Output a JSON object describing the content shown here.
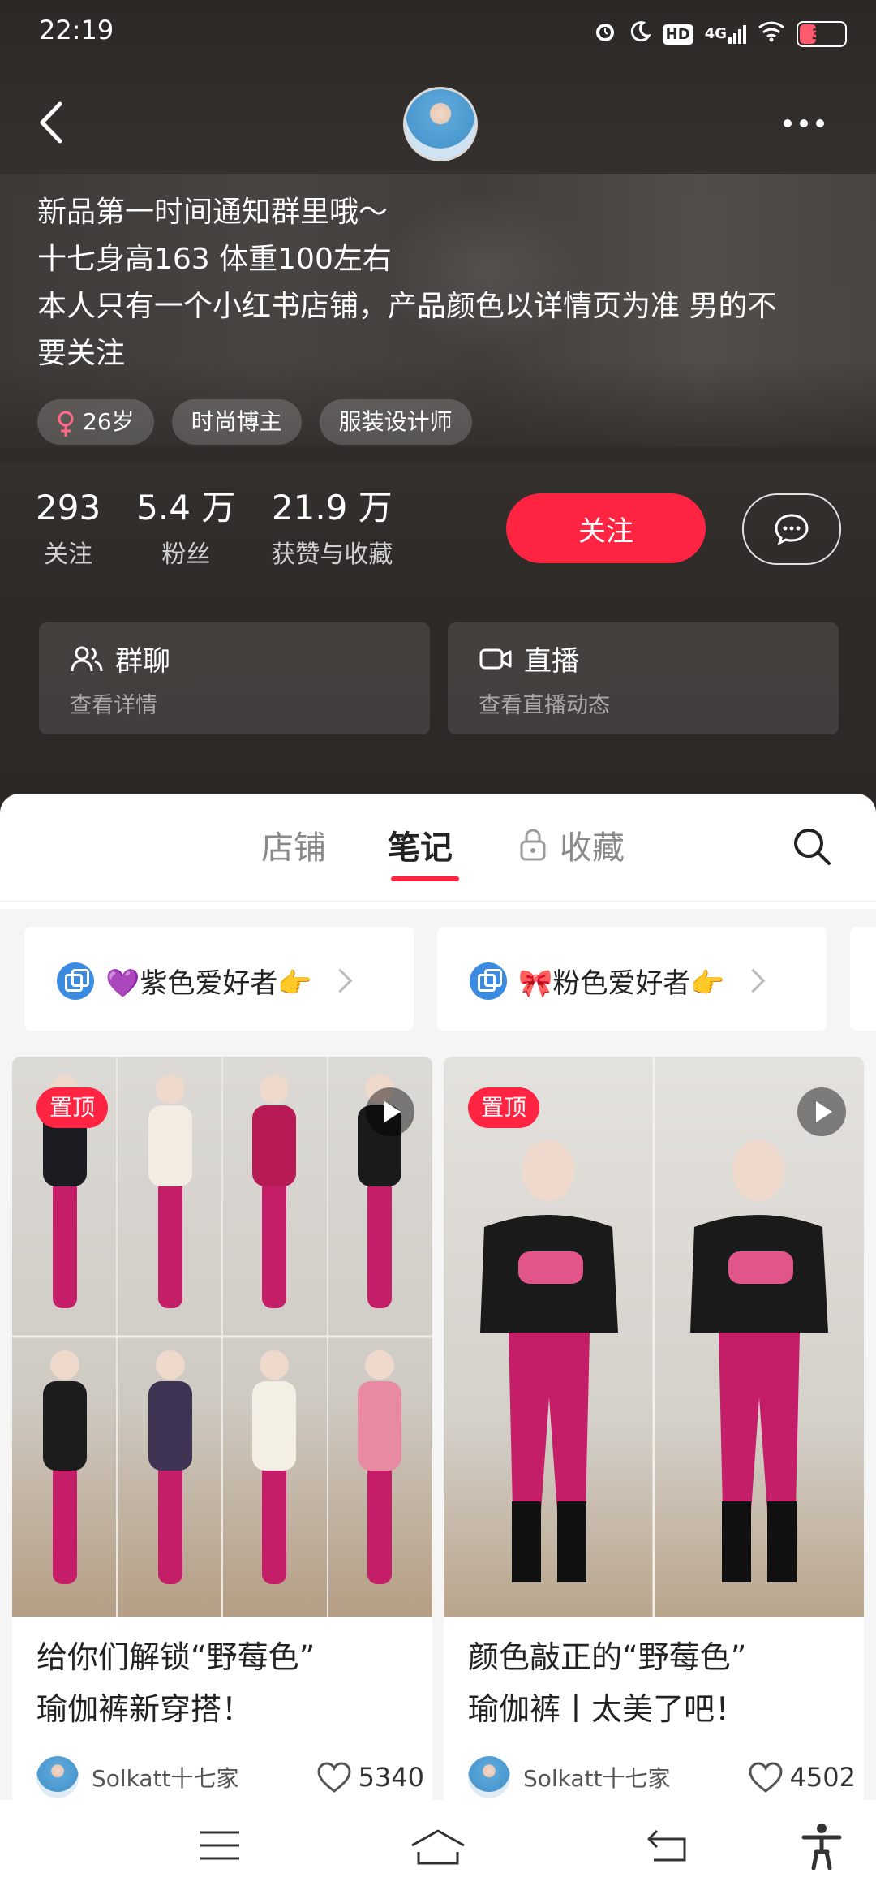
{
  "status_bar": {
    "time": "22:19",
    "network": "4G",
    "hd": "HD",
    "battery": "32",
    "icons": [
      "alarm-icon",
      "moon-icon",
      "hd-icon",
      "signal-icon",
      "wifi-icon",
      "battery-icon"
    ]
  },
  "profile": {
    "bio_cut_line": "",
    "bio_lines": [
      "新品第一时间通知群里哦～",
      "十七身高163 体重100左右",
      "本人只有一个小红书店铺，产品颜色以详情页为准 男的不",
      "要关注"
    ],
    "tags": [
      "26岁",
      "时尚博主",
      "服装设计师"
    ],
    "stats": [
      {
        "num": "293",
        "label": "关注"
      },
      {
        "num": "5.4 万",
        "label": "粉丝"
      },
      {
        "num": "21.9 万",
        "label": "获赞与收藏"
      }
    ],
    "follow_label": "关注",
    "cards": [
      {
        "title": "群聊",
        "sub": "查看详情"
      },
      {
        "title": "直播",
        "sub": "查看直播动态"
      }
    ]
  },
  "tabs": [
    "店铺",
    "笔记",
    "收藏"
  ],
  "active_tab": "笔记",
  "collections": [
    "💜紫色爱好者👉",
    "🎀粉色爱好者👉"
  ],
  "notes": [
    {
      "badge": "置顶",
      "title_line1": "给你们解锁“野莓色”",
      "title_line2": "瑜伽裤新穿搭！",
      "author": "Solkatt十七家",
      "likes": "5340"
    },
    {
      "badge": "置顶",
      "title_line1": "颜色敲正的“野莓色”",
      "title_line2": "瑜伽裤丨太美了吧！",
      "author": "Solkatt十七家",
      "likes": "4502"
    }
  ],
  "colors": {
    "accent": "#ff2442",
    "header_bg": "#2b2826",
    "collection_icon": "#3b8be0"
  }
}
